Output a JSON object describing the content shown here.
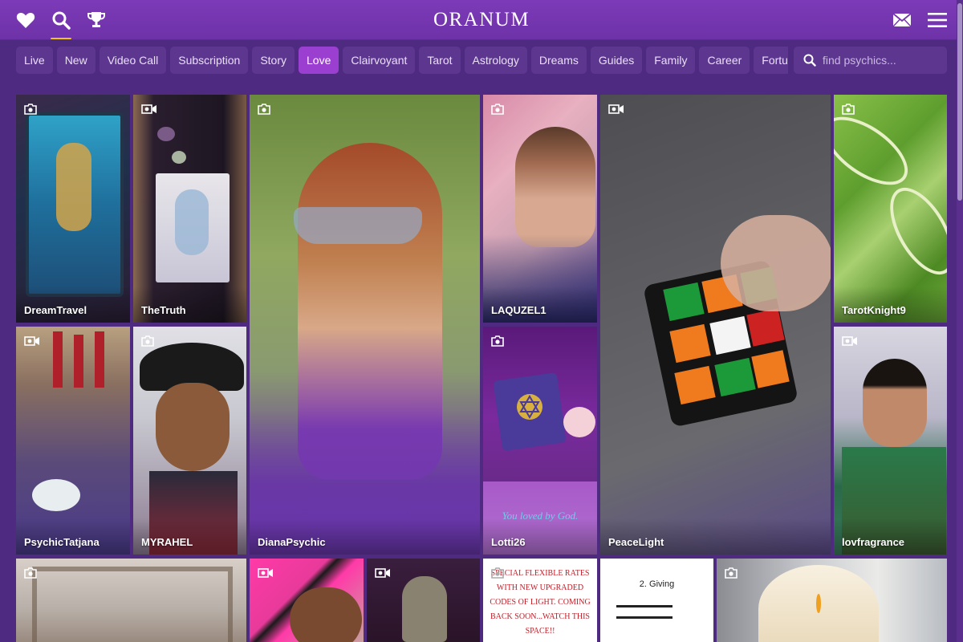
{
  "header": {
    "logo": "ORANUM",
    "icons": [
      "heart-icon",
      "search-icon",
      "trophy-icon",
      "envelope-icon",
      "hamburger-menu-icon"
    ],
    "accent": "#f1c40f"
  },
  "tabs": [
    {
      "label": "Live"
    },
    {
      "label": "New"
    },
    {
      "label": "Video Call"
    },
    {
      "label": "Subscription"
    },
    {
      "label": "Story"
    },
    {
      "label": "Love",
      "active": true
    },
    {
      "label": "Clairvoyant"
    },
    {
      "label": "Tarot"
    },
    {
      "label": "Astrology"
    },
    {
      "label": "Dreams"
    },
    {
      "label": "Guides"
    },
    {
      "label": "Family"
    },
    {
      "label": "Career"
    },
    {
      "label": "Fortu"
    }
  ],
  "search": {
    "placeholder": "find psychics..."
  },
  "cards": [
    {
      "name": "DreamTravel",
      "media": "photo"
    },
    {
      "name": "TheTruth",
      "media": "video"
    },
    {
      "name": "DianaPsychic",
      "media": "photo"
    },
    {
      "name": "LAQUZEL1",
      "media": "photo"
    },
    {
      "name": "PeaceLight",
      "media": "video"
    },
    {
      "name": "TarotKnight9",
      "media": "photo"
    },
    {
      "name": "PsychicTatjana",
      "media": "video"
    },
    {
      "name": "MYRAHEL",
      "media": "photo"
    },
    {
      "name": "Lotti26",
      "media": "photo",
      "caption": "You loved by God."
    },
    {
      "name": "lovfragrance",
      "media": "video"
    },
    {
      "name": "",
      "media": "photo"
    },
    {
      "name": "",
      "media": "video"
    },
    {
      "name": "",
      "media": "video"
    },
    {
      "name": "",
      "media": "photo",
      "caption": "SPECIAL FLEXIBLE RATES WITH NEW UPGRADED CODES OF LIGHT. COMING BACK SOON...WATCH THIS SPACE!!"
    },
    {
      "name": "",
      "media": "photo",
      "caption": "2. Giving"
    },
    {
      "name": "",
      "media": "photo"
    }
  ]
}
